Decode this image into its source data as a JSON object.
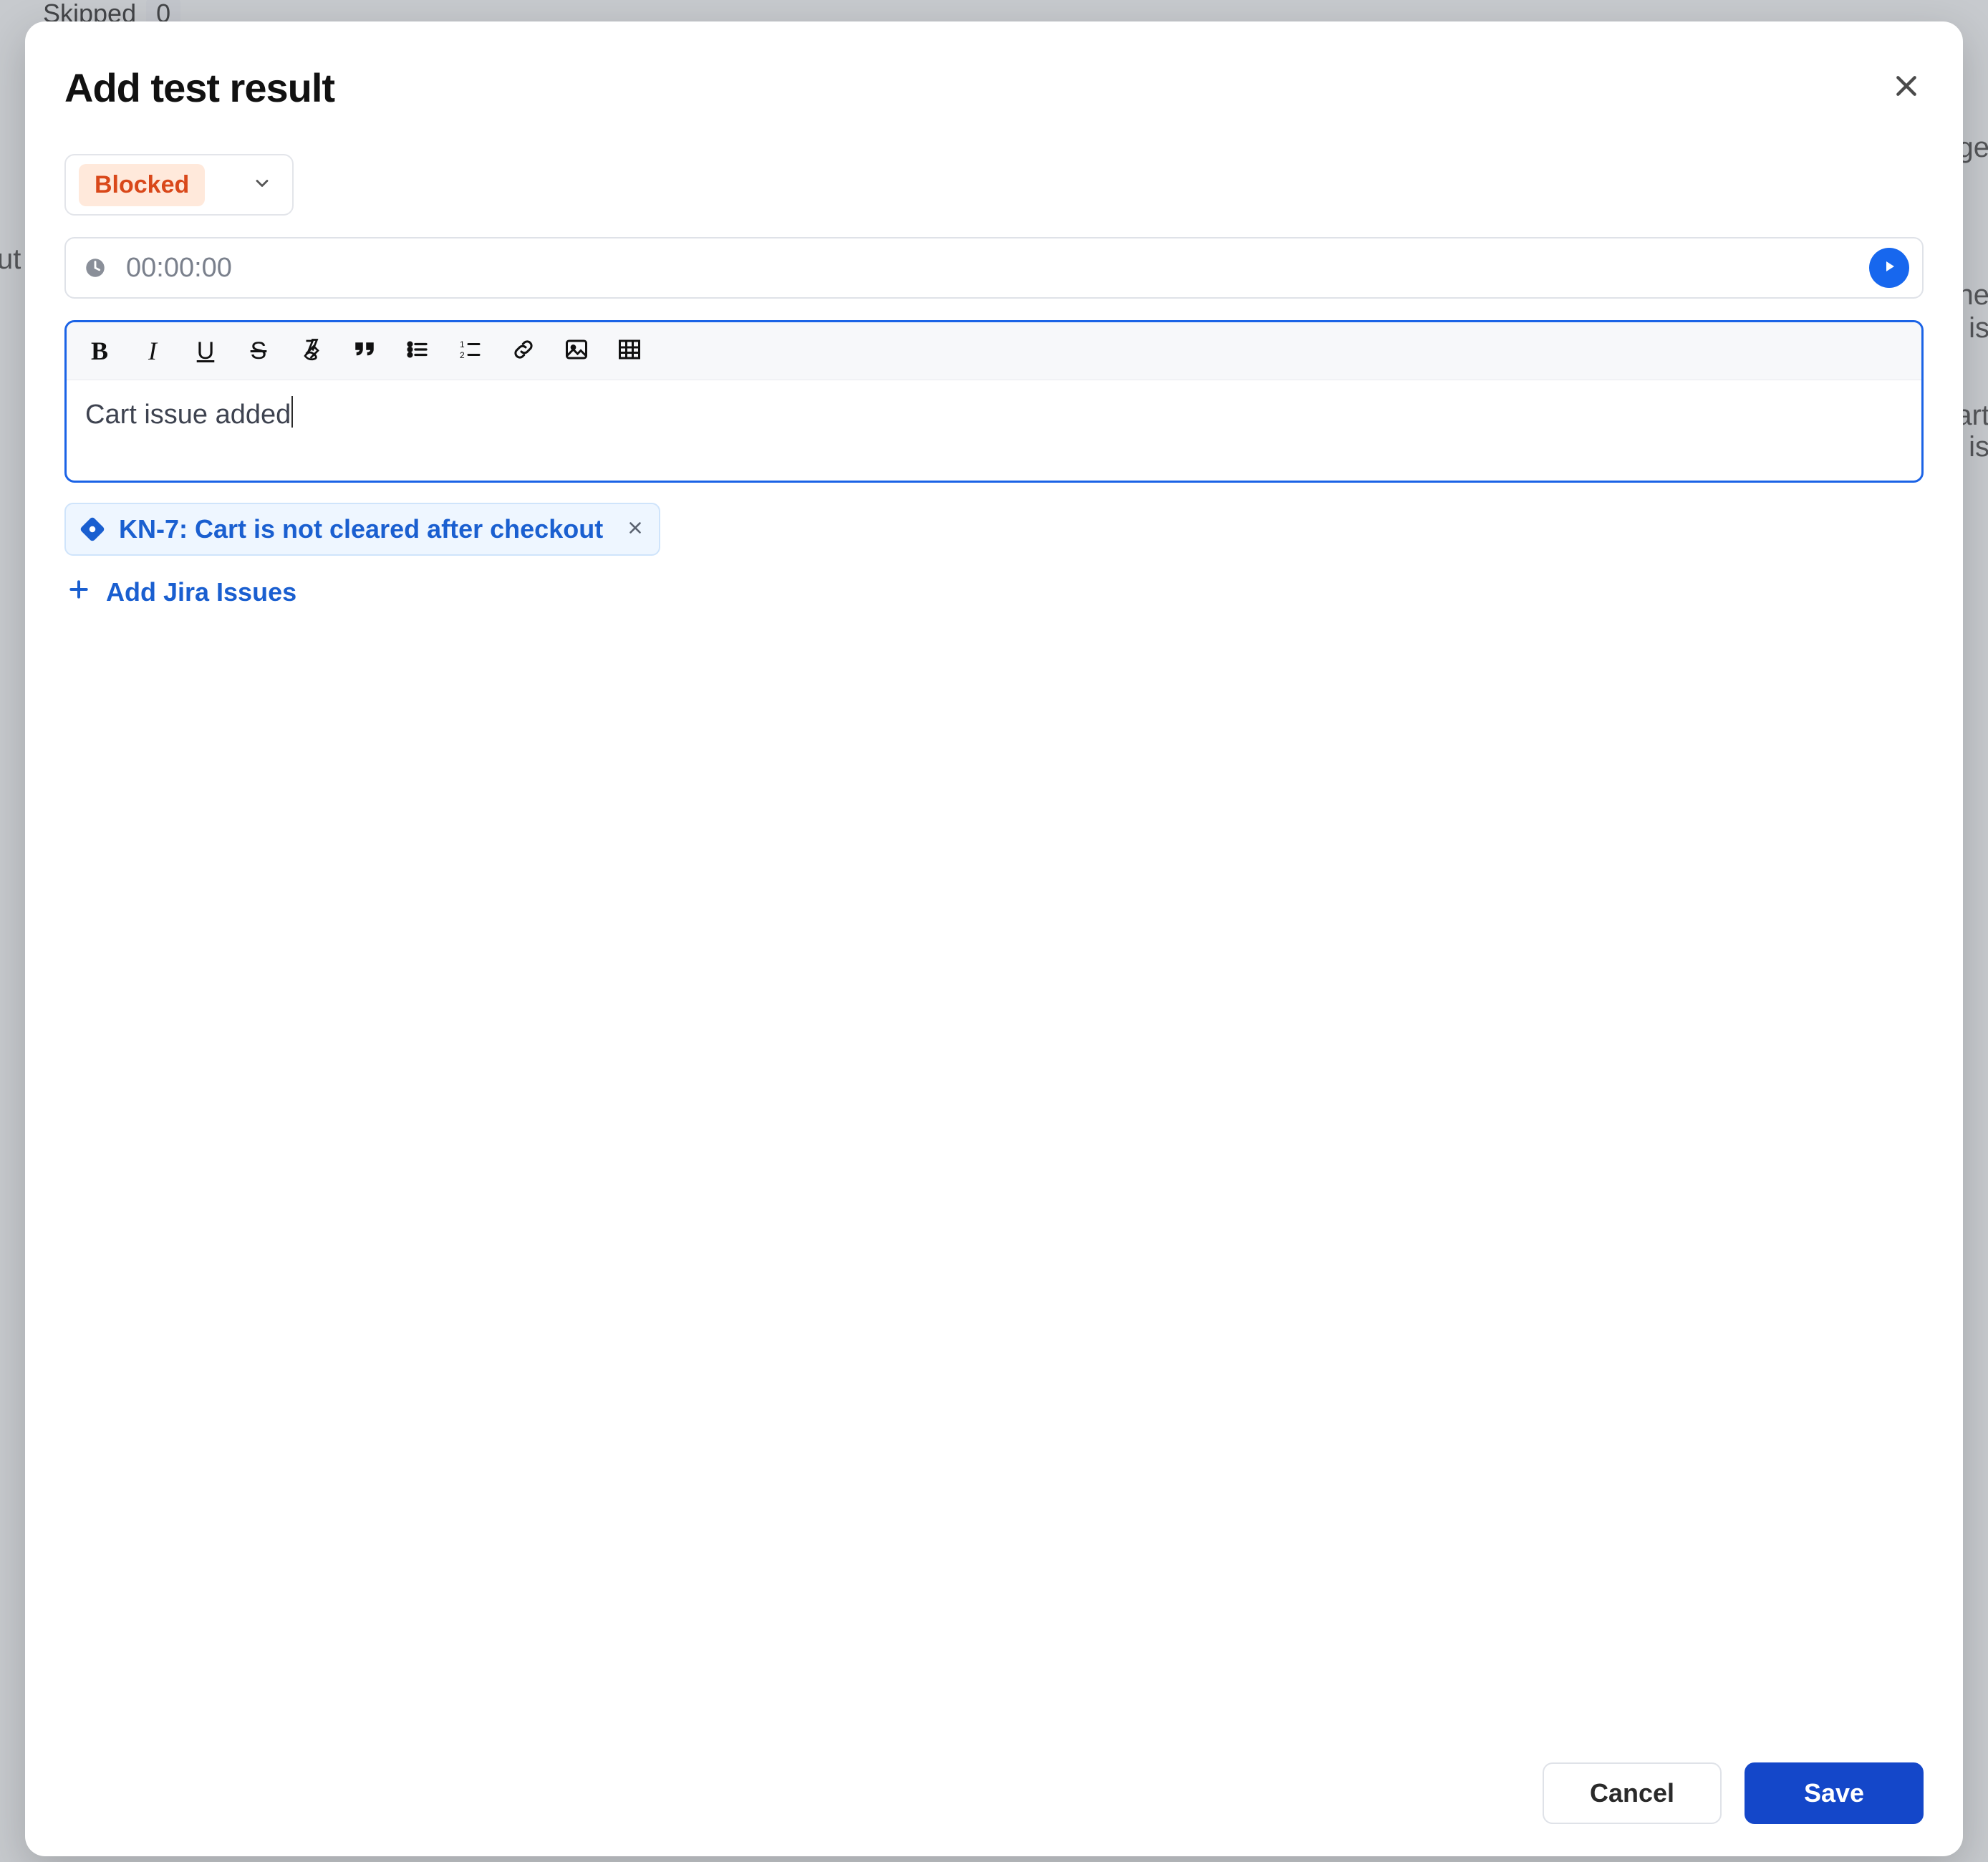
{
  "background": {
    "skipped_label": "Skipped",
    "skipped_count": "0",
    "frag_out": "ut",
    "frag_ge": "ge",
    "frag_ne": "ne",
    "frag_is": "is",
    "frag_art": "art",
    "frag_eis": "e is"
  },
  "modal": {
    "title": "Add test result",
    "status": {
      "selected": "Blocked"
    },
    "timer": {
      "value": "00:00:00"
    },
    "editor": {
      "text": "Cart issue added"
    },
    "linked_issue": {
      "label": "KN-7: Cart is not cleared after checkout"
    },
    "add_issues_label": "Add Jira Issues",
    "buttons": {
      "cancel": "Cancel",
      "save": "Save"
    }
  }
}
